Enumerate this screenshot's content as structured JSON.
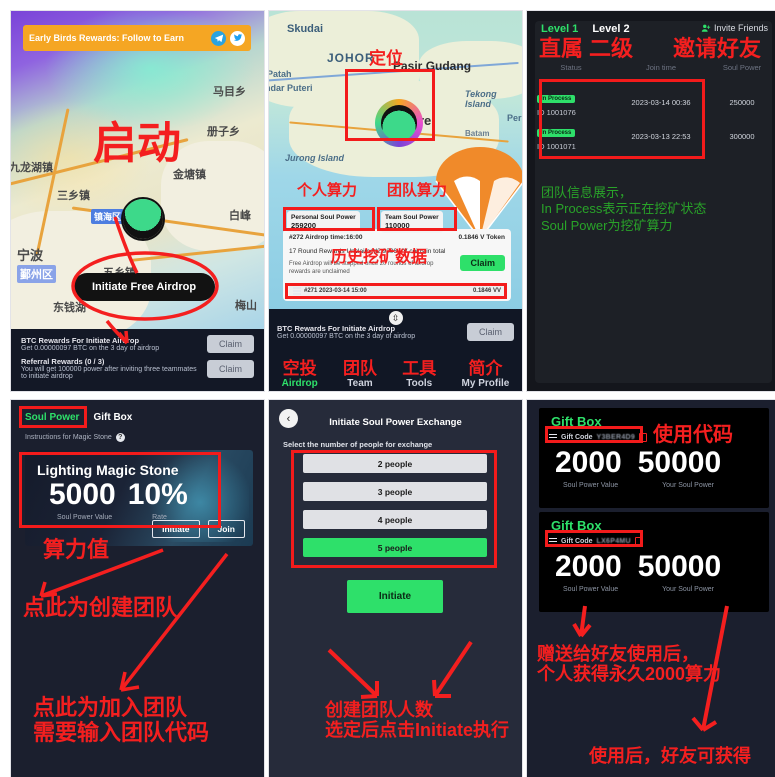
{
  "panel1": {
    "banner": {
      "text": "Early Birds Rewards: Follow to Earn",
      "telegram_icon": "telegram-icon",
      "twitter_icon": "twitter-icon"
    },
    "map_labels": [
      "马目乡",
      "册子乡",
      "九龙湖镇",
      "金塘镇",
      "宁波",
      "鄞州区",
      "五乡镇",
      "东钱湖",
      "梅山",
      "镇海区",
      "三乡镇",
      "白峰"
    ],
    "cta": "Initiate Free Airdrop",
    "rewards": [
      {
        "title": "BTC Rewards For Initiate Airdrop",
        "sub": "Get 0.00000097 BTC on the 3 day of airdrop",
        "button": "Claim"
      },
      {
        "title": "Referral Rewards (0 / 3)",
        "sub": "You will get 100000 power after inviting three teammates to initiate airdrop",
        "button": "Claim"
      }
    ],
    "annotation": "启动"
  },
  "panel2": {
    "map_labels": [
      "Skudai",
      "JOHOR",
      "Pasir Gudang",
      "Tekong Island",
      "Patah",
      "ndar Puteri",
      "Jurong Island",
      "ore",
      "Per",
      "Batam"
    ],
    "personal": {
      "label": "Personal Soul Power",
      "value": "259200"
    },
    "team": {
      "label": "Team Soul Power",
      "value": "110000"
    },
    "card": {
      "round": "#272 Airdrop time:16:00",
      "token": "0.1846 V Token",
      "summary": "17 Round Rewards Unclaimed2.9206 VV coins in total",
      "note": "Free Airdrop will be stopped once 20 rounds of airdrop rewards are unclaimed",
      "claim": "Claim",
      "history_left": "#271 2023-03-14 15:00",
      "history_right": "0.1846 VV"
    },
    "reward_title": "BTC Rewards For Initiate Airdrop",
    "reward_sub": "Get 0.00000097 BTC on the 3 day of airdrop",
    "reward_btn": "Claim",
    "nav": [
      {
        "cn": "空投",
        "en": "Airdrop",
        "active": true
      },
      {
        "cn": "团队",
        "en": "Team",
        "active": false
      },
      {
        "cn": "工具",
        "en": "Tools",
        "active": false
      },
      {
        "cn": "简介",
        "en": "My Profile",
        "active": false
      }
    ],
    "annotations": {
      "locate": "定位",
      "personal": "个人算力",
      "team": "团队算力",
      "history": "历史挖矿数据"
    }
  },
  "panel3": {
    "level1": "Level 1",
    "level2": "Level 2",
    "invite": "Invite Friends",
    "invite_icon": "invite-friends-icon",
    "headers": [
      "Status",
      "Join time",
      "Soul Power"
    ],
    "rows": [
      {
        "status": "In Process",
        "id": "ID 1001076",
        "join": "2023-03-14 00:36",
        "power": "250000"
      },
      {
        "status": "In Process",
        "id": "ID 1001071",
        "join": "2023-03-13 22:53",
        "power": "300000"
      }
    ],
    "annotations": {
      "direct": "直属",
      "second": "二级",
      "invite": "邀请好友"
    },
    "note": "团队信息展示，\nIn Process表示正在挖矿状态\nSoul Power为挖矿算力"
  },
  "panel4": {
    "tabs": [
      {
        "label": "Soul Power",
        "selected": true
      },
      {
        "label": "Gift Box",
        "selected": false
      }
    ],
    "instructions": "Instructions for Magic Stone",
    "help_icon": "question-mark-icon",
    "stone": {
      "title": "Lighting Magic Stone",
      "value": "5000",
      "rate": "10%",
      "value_label": "Soul Power Value",
      "rate_label": "Rate"
    },
    "buttons": {
      "initiate": "Initiate",
      "join": "Join"
    },
    "annotations": {
      "power_value": "算力值",
      "create": "点此为创建团队",
      "join": "点此为加入团队\n需要输入团队代码"
    }
  },
  "panel5": {
    "back_icon": "back-chevron-icon",
    "title": "Initiate Soul Power Exchange",
    "sublabel": "Select the number of people for exchange",
    "options": [
      {
        "label": "2 people",
        "selected": false
      },
      {
        "label": "3 people",
        "selected": false
      },
      {
        "label": "4 people",
        "selected": false
      },
      {
        "label": "5 people",
        "selected": true
      }
    ],
    "initiate": "Initiate",
    "annotation": "创建团队人数\n选定后点击Initiate执行"
  },
  "panel6": {
    "boxes": [
      {
        "title": "Gift Box",
        "code_label": "Gift Code",
        "code": "Y3BER4D9",
        "menu_icon": "hamburger-icon",
        "copy_icon": "copy-icon",
        "value": "2000",
        "your_power": "50000",
        "value_label": "Soul Power Value",
        "power_label": "Your Soul Power"
      },
      {
        "title": "Gift Box",
        "code_label": "Gift Code",
        "code": "LX6P4MU",
        "menu_icon": "hamburger-icon",
        "copy_icon": "copy-icon",
        "value": "2000",
        "your_power": "50000",
        "value_label": "Soul Power Value",
        "power_label": "Your Soul Power"
      }
    ],
    "annotations": {
      "use_code": "使用代码",
      "gift_note": "赠送给好友使用后，\n个人获得永久2000算力",
      "friend_note": "使用后，好友可获得"
    }
  },
  "colors": {
    "accent_green": "#2ee06a",
    "annotation_red": "#f41f1f",
    "orange_banner": "#f5a623",
    "panel_bg": "#1b1f2e"
  }
}
